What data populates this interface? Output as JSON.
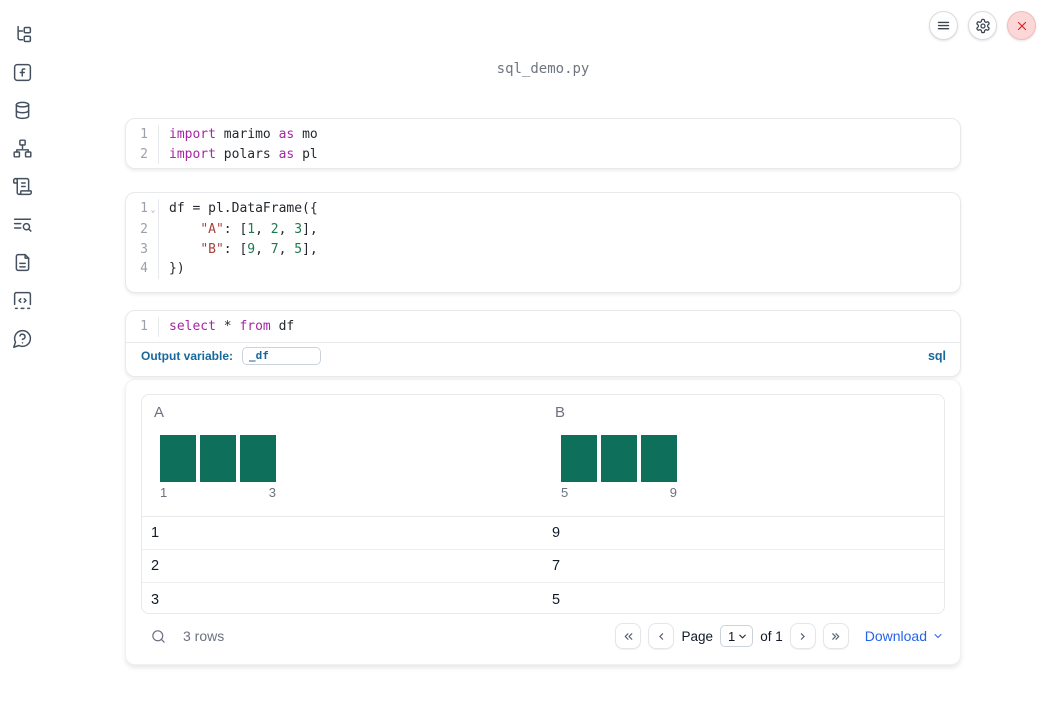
{
  "app": {
    "title": "sql_demo.py"
  },
  "colors": {
    "keyword": "#a626a4",
    "string": "#a8423b",
    "number": "#1b7a4f",
    "accent_blue": "#17689b",
    "download_blue": "#2563eb",
    "histogram_bar": "#0e6f5a",
    "close_red": "#dc2626"
  },
  "sidebar": {
    "items": [
      {
        "icon": "file-tree-icon"
      },
      {
        "icon": "function-square-icon"
      },
      {
        "icon": "database-icon"
      },
      {
        "icon": "network-icon"
      },
      {
        "icon": "scroll-icon"
      },
      {
        "icon": "list-search-icon"
      },
      {
        "icon": "file-text-icon"
      },
      {
        "icon": "code-square-icon"
      },
      {
        "icon": "help-bubble-icon"
      }
    ]
  },
  "cells": [
    {
      "lines": [
        {
          "num": "1",
          "tokens": [
            [
              "import",
              "kw"
            ],
            [
              " marimo ",
              "pl"
            ],
            [
              "as",
              "kw"
            ],
            [
              " mo",
              "pl"
            ]
          ]
        },
        {
          "num": "2",
          "tokens": [
            [
              "import",
              "kw"
            ],
            [
              " polars ",
              "pl"
            ],
            [
              "as",
              "kw"
            ],
            [
              " pl",
              "pl"
            ]
          ]
        }
      ]
    },
    {
      "lines": [
        {
          "num": "1",
          "fold": true,
          "tokens": [
            [
              "df = pl.DataFrame({",
              "pl"
            ]
          ]
        },
        {
          "num": "2",
          "tokens": [
            [
              "    ",
              "pl"
            ],
            [
              "\"A\"",
              "str"
            ],
            [
              ": [",
              "pl"
            ],
            [
              "1",
              "num"
            ],
            [
              ", ",
              "pl"
            ],
            [
              "2",
              "num"
            ],
            [
              ", ",
              "pl"
            ],
            [
              "3",
              "num"
            ],
            [
              "],",
              "pl"
            ]
          ]
        },
        {
          "num": "3",
          "tokens": [
            [
              "    ",
              "pl"
            ],
            [
              "\"B\"",
              "str"
            ],
            [
              ": [",
              "pl"
            ],
            [
              "9",
              "num"
            ],
            [
              ", ",
              "pl"
            ],
            [
              "7",
              "num"
            ],
            [
              ", ",
              "pl"
            ],
            [
              "5",
              "num"
            ],
            [
              "],",
              "pl"
            ]
          ]
        },
        {
          "num": "4",
          "tokens": [
            [
              "})",
              "pl"
            ]
          ]
        }
      ]
    },
    {
      "lines": [
        {
          "num": "1",
          "tokens": [
            [
              "select",
              "kw"
            ],
            [
              " * ",
              "pl"
            ],
            [
              "from",
              "kw"
            ],
            [
              " df",
              "pl"
            ]
          ]
        }
      ]
    }
  ],
  "sql_cell": {
    "output_variable_label": "Output variable:",
    "output_variable_value": "_df",
    "language_badge": "sql"
  },
  "table": {
    "columns": [
      {
        "name": "A",
        "hist": {
          "bar_count": 3,
          "bar_heights": [
            1,
            1,
            1
          ],
          "tick_left": "1",
          "tick_right": "3"
        }
      },
      {
        "name": "B",
        "hist": {
          "bar_count": 3,
          "bar_heights": [
            1,
            1,
            1
          ],
          "tick_left": "5",
          "tick_right": "9"
        }
      }
    ],
    "rows": [
      [
        "1",
        "9"
      ],
      [
        "2",
        "7"
      ],
      [
        "3",
        "5"
      ]
    ]
  },
  "table_footer": {
    "rows_count": "3 rows",
    "page_label": "Page",
    "page_value": "1",
    "of_label": "of 1",
    "download_label": "Download"
  }
}
